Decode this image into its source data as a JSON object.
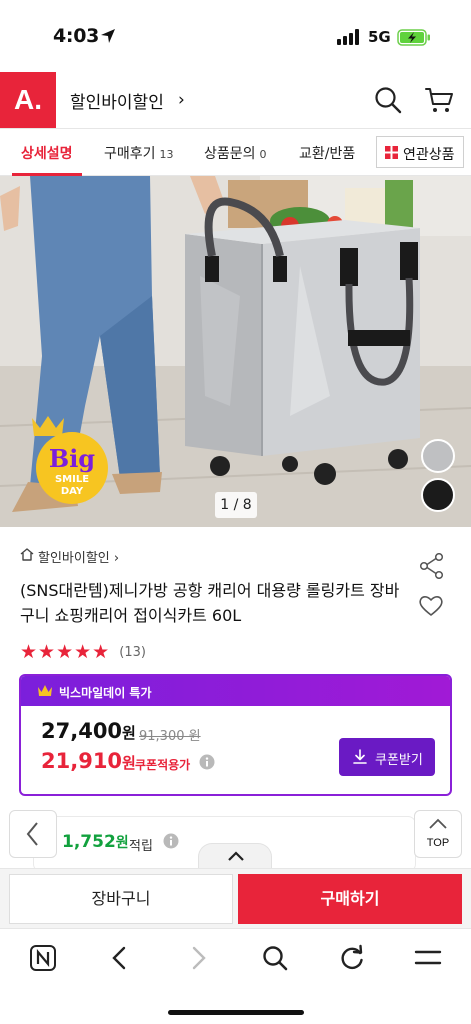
{
  "status_bar": {
    "time": "4:03",
    "network": "5G",
    "location_icon": "location-arrow-icon",
    "signal_icon": "signal-bars-icon",
    "battery_icon": "battery-charging-icon"
  },
  "header": {
    "logo_text": "A.",
    "store_name": "할인바이할인",
    "store_chevron": "›",
    "icons": [
      "search-icon",
      "cart-icon"
    ],
    "brand_color": "#e8243a"
  },
  "tabs": [
    {
      "label": "상세설명",
      "active": true
    },
    {
      "label": "구매후기",
      "count": "13"
    },
    {
      "label": "상품문의",
      "count": "0"
    },
    {
      "label": "교환/반품"
    }
  ],
  "related_button": {
    "label": "연관상품",
    "icon": "grid-icon"
  },
  "hero": {
    "counter": "1 / 8",
    "badge": {
      "line1": "Big",
      "line2": "SMILE",
      "line3": "DAY"
    },
    "color_swatches": [
      "#bfc0c2",
      "#1b1b1b"
    ]
  },
  "product": {
    "breadcrumb": "할인바이할인 ›",
    "title": "(SNS대란템)제니가방 공항 캐리어 대용량 롤링카트 장바구니 쇼핑캐리어 접이식카트 60L",
    "stars": "★★★★★",
    "rating_value": 5,
    "review_count": "(13)"
  },
  "price_box": {
    "event_label": "빅스마일데이 특가",
    "price": "27,400",
    "price_unit": "원",
    "original_price": "91,300 원",
    "coupon_price": "21,910",
    "coupon_price_unit": "원",
    "coupon_label": "쿠폰적용가",
    "coupon_button": "쿠폰받기",
    "accent_color": "#8a20d8"
  },
  "points": {
    "amount": "1,752",
    "unit": "원",
    "label": "적립"
  },
  "floating": {
    "top_label": "TOP"
  },
  "action_bar": {
    "cart_label": "장바구니",
    "buy_label": "구매하기"
  },
  "browser_bar": {
    "icons": [
      "naver-home-icon",
      "back-icon",
      "forward-icon",
      "search-icon",
      "refresh-icon",
      "menu-icon"
    ]
  }
}
